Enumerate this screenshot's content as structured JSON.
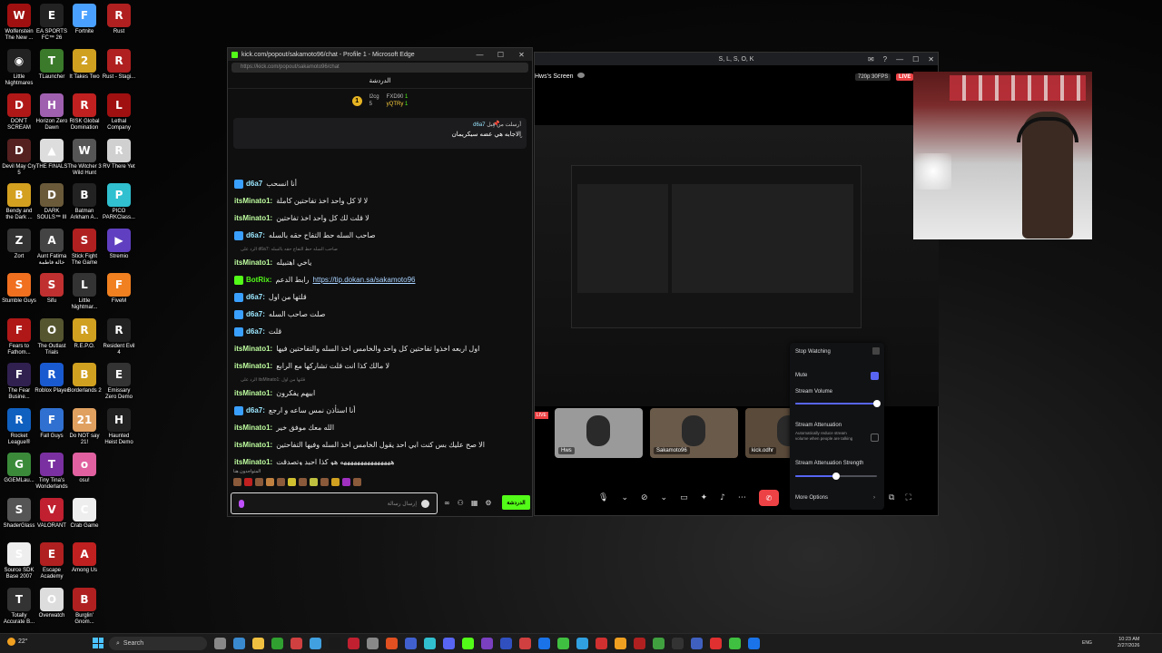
{
  "desktop": {
    "icons": [
      {
        "label": "Wolfenstein The New ...",
        "color": "#a01010",
        "glyph": "W"
      },
      {
        "label": "Little Nightmares",
        "color": "#222",
        "glyph": "◉"
      },
      {
        "label": "DON'T SCREAM",
        "color": "#b01818",
        "glyph": "D"
      },
      {
        "label": "Devil May Cry 5",
        "color": "#552020",
        "glyph": "D"
      },
      {
        "label": "Bendy and the Dark ...",
        "color": "#d4a020",
        "glyph": "B"
      },
      {
        "label": "Zort",
        "color": "#333",
        "glyph": "Z"
      },
      {
        "label": "Stumble Guys",
        "color": "#f07020",
        "glyph": "S"
      },
      {
        "label": "Fears to Fathom...",
        "color": "#b01818",
        "glyph": "F"
      },
      {
        "label": "The Fear Busine...",
        "color": "#302050",
        "glyph": "F"
      },
      {
        "label": "Rocket League®",
        "color": "#1060c0",
        "glyph": "R"
      },
      {
        "label": "GGEMLau...",
        "color": "#3a8a3a",
        "glyph": "G"
      },
      {
        "label": "ShaderGlass",
        "color": "#555",
        "glyph": "S"
      },
      {
        "label": "Source SDK Base 2007",
        "color": "#eee",
        "glyph": "S"
      },
      {
        "label": "Totally Accurate B...",
        "color": "#333",
        "glyph": "T"
      },
      {
        "label": "EA SPORTS FC™ 26",
        "color": "#222",
        "glyph": "E"
      },
      {
        "label": "TLauncher",
        "color": "#3a7a2a",
        "glyph": "T"
      },
      {
        "label": "Horizon Zero Dawn",
        "color": "#a060b0",
        "glyph": "H"
      },
      {
        "label": "THE FINALS",
        "color": "#ddd",
        "glyph": "▲"
      },
      {
        "label": "DARK SOULS™ III",
        "color": "#6a5a3a",
        "glyph": "D"
      },
      {
        "label": "Aunt Fatima خالة فاطمة",
        "color": "#444",
        "glyph": "A"
      },
      {
        "label": "Sifu",
        "color": "#c03030",
        "glyph": "S"
      },
      {
        "label": "The Outlast Trials",
        "color": "#555530",
        "glyph": "O"
      },
      {
        "label": "Roblox Player",
        "color": "#1a5ad0",
        "glyph": "R"
      },
      {
        "label": "Fall Guys",
        "color": "#3070d0",
        "glyph": "F"
      },
      {
        "label": "Tiny Tina's Wonderlands",
        "color": "#7a30a0",
        "glyph": "T"
      },
      {
        "label": "VALORANT",
        "color": "#c02030",
        "glyph": "V"
      },
      {
        "label": "Escape Academy",
        "color": "#b02020",
        "glyph": "E"
      },
      {
        "label": "Overwatch",
        "color": "#ddd",
        "glyph": "O"
      },
      {
        "label": "Fortnite",
        "color": "#4aa0ff",
        "glyph": "F"
      },
      {
        "label": "It Takes Two",
        "color": "#d0a020",
        "glyph": "2"
      },
      {
        "label": "RISK Global Domination",
        "color": "#c02020",
        "glyph": "R"
      },
      {
        "label": "The Witcher 3 Wild Hunt",
        "color": "#555",
        "glyph": "W"
      },
      {
        "label": "Batman Arkham A...",
        "color": "#222",
        "glyph": "B"
      },
      {
        "label": "Stick Fight The Game",
        "color": "#b02020",
        "glyph": "S"
      },
      {
        "label": "Little Nightmar...",
        "color": "#333",
        "glyph": "L"
      },
      {
        "label": "R.E.P.O.",
        "color": "#d0a020",
        "glyph": "R"
      },
      {
        "label": "Borderlands 2",
        "color": "#d0a020",
        "glyph": "B"
      },
      {
        "label": "Do NOT say 21!",
        "color": "#e0a060",
        "glyph": "21"
      },
      {
        "label": "osu!",
        "color": "#e060a0",
        "glyph": "o"
      },
      {
        "label": "Crab Game",
        "color": "#eee",
        "glyph": "C"
      },
      {
        "label": "Among Us",
        "color": "#c02020",
        "glyph": "A"
      },
      {
        "label": "Burglin' Gnom...",
        "color": "#b02020",
        "glyph": "B"
      },
      {
        "label": "Rust",
        "color": "#b02020",
        "glyph": "R"
      },
      {
        "label": "Rust - Stagi...",
        "color": "#b02020",
        "glyph": "R"
      },
      {
        "label": "Lethal Company",
        "color": "#a01010",
        "glyph": "L"
      },
      {
        "label": "RV There Yet",
        "color": "#d0d0d0",
        "glyph": "R"
      },
      {
        "label": "PICO PARKClass...",
        "color": "#30c0d0",
        "glyph": "P"
      },
      {
        "label": "Stremio",
        "color": "#6040c0",
        "glyph": "▶"
      },
      {
        "label": "FiveM",
        "color": "#f08020",
        "glyph": "F"
      },
      {
        "label": "Resident Evil 4",
        "color": "#222",
        "glyph": "R"
      },
      {
        "label": "Emissary Zero Demo",
        "color": "#333",
        "glyph": "E"
      },
      {
        "label": "Haunted Heist Demo",
        "color": "#222",
        "glyph": "H"
      }
    ]
  },
  "edge": {
    "title": "kick.com/popout/sakamoto96/chat - Profile 1 - Microsoft Edge",
    "url": "https://kick.com/popout/sakamoto96/chat",
    "minimize": "—",
    "maximize": "☐",
    "close": "✕",
    "chat_title": "الدردشة",
    "leaderboard": {
      "rank_number": "1",
      "left_name": "l2cg",
      "left_count": "5",
      "top_name": "FXD90",
      "top_count": "1",
      "second_name": "yQTRy",
      "second_count": "1"
    },
    "pinned": {
      "header": "أرسلت من قِبل",
      "user": "d6a7",
      "message": "الاجابه هي عضه سيكريمان"
    },
    "messages": [
      {
        "type": "msg",
        "user": "d6a7",
        "badge": "sub",
        "text": "أنا انسحب",
        "uclass": "c-d6a7"
      },
      {
        "type": "msg",
        "user": "itsMinato1:",
        "badge": "",
        "text": "لا لا كل واحد اخذ تفاحتين كاملة",
        "uclass": "c-itsm"
      },
      {
        "type": "msg",
        "user": "itsMinato1:",
        "badge": "",
        "text": "لا قلت لك كل واحد اخذ تفاحتين",
        "uclass": "c-itsm"
      },
      {
        "type": "msg",
        "user": "d6a7:",
        "badge": "sub",
        "text": "صاحب السله حط التفاح حقه بالسله",
        "uclass": "c-d6a7"
      },
      {
        "type": "reply",
        "text": "الرد على d6a7: صاحب السله حط التفاح حقه بالسله"
      },
      {
        "type": "msg",
        "user": "itsMinato1:",
        "badge": "",
        "text": "ياخي اهتبيله",
        "uclass": "c-itsm"
      },
      {
        "type": "msg",
        "user": "BotRix:",
        "badge": "bot",
        "text": "رابط الدعم",
        "link": "https://tip.dokan.sa/sakamoto96",
        "uclass": "c-bot"
      },
      {
        "type": "msg",
        "user": "d6a7:",
        "badge": "sub",
        "text": "قلتها من اول",
        "uclass": "c-d6a7"
      },
      {
        "type": "msg",
        "user": "d6a7:",
        "badge": "sub",
        "text": "صلت صاحب السله",
        "uclass": "c-d6a7"
      },
      {
        "type": "msg",
        "user": "d6a7:",
        "badge": "sub",
        "text": "قلت",
        "uclass": "c-d6a7"
      },
      {
        "type": "msg",
        "user": "itsMinato1:",
        "badge": "",
        "text": "اول اربعه اخذوا تفاحتين كل واحد والخامس اخذ السله والتفاحتين فيها",
        "uclass": "c-itsm"
      },
      {
        "type": "msg",
        "user": "itsMinato1:",
        "badge": "",
        "text": "لا مالك كذا انت قلت تشاركها مع الرابع",
        "uclass": "c-itsm"
      },
      {
        "type": "reply",
        "text": "الرد على itsMinato1: قلتها من اول"
      },
      {
        "type": "msg",
        "user": "itsMinato1:",
        "badge": "",
        "text": "ابيهم يفكرون",
        "uclass": "c-itsm"
      },
      {
        "type": "msg",
        "user": "d6a7:",
        "badge": "sub",
        "text": "أنا استأذن نمس ساعه و ارجع",
        "uclass": "c-d6a7"
      },
      {
        "type": "msg",
        "user": "itsMinato1:",
        "badge": "",
        "text": "الله معك موفق خير",
        "uclass": "c-itsm"
      },
      {
        "type": "msg",
        "user": "itsMinato1:",
        "badge": "",
        "text": "الا صح عليك بس كنت ابي احد يقول الخامس اخذ السله وفيها التفاحتين",
        "uclass": "c-itsm"
      },
      {
        "type": "msg",
        "user": "itsMinato1:",
        "badge": "",
        "text": "هههههههههههههههه هو كذا احبد وتصدقت",
        "uclass": "c-itsm"
      }
    ],
    "footer_label": "المتواجدون هنا",
    "input_placeholder": "إرسال رسالة",
    "send_label": "الدردشة"
  },
  "discord": {
    "title": "S, L, S, O, K",
    "screen_label": "Hws's Screen",
    "quality": "720p 30FPS",
    "live": "LIVE",
    "participants": [
      {
        "name": "Hws"
      },
      {
        "name": "Sakamoto96"
      },
      {
        "name": "kick.odhr"
      }
    ],
    "menu": {
      "stop_watching": "Stop Watching",
      "mute": "Mute",
      "stream_volume": "Stream Volume",
      "stream_volume_value": 1.0,
      "stream_attenuation": "Stream Attenuation",
      "stream_attenuation_desc": "Automatically reduce stream volume when people are talking",
      "attenuation_strength": "Stream Attenuation Strength",
      "attenuation_strength_value": 0.5,
      "more_options": "More Options"
    }
  },
  "taskbar": {
    "weather_temp": "22°",
    "search_placeholder": "Search",
    "lang": "ENG",
    "time": "10:23 AM",
    "date": "2/27/2026"
  }
}
